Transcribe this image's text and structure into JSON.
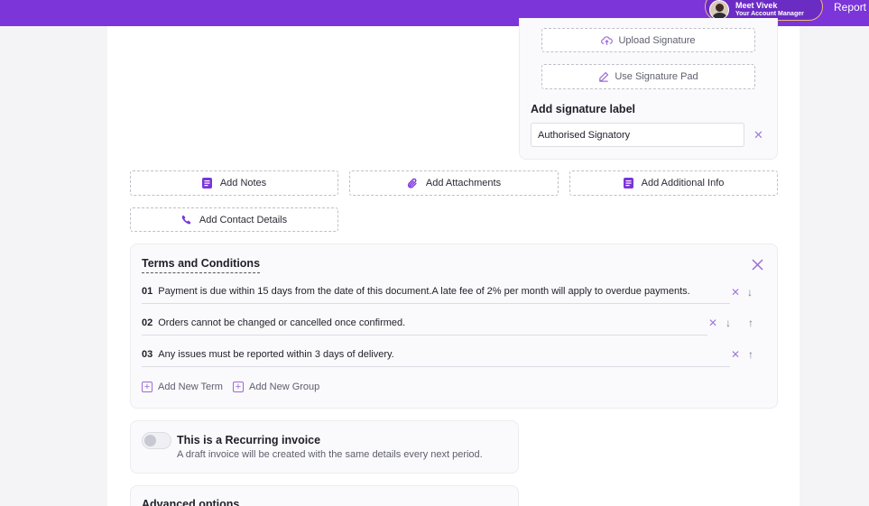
{
  "topbar": {
    "manager_name": "Meet Vivek",
    "manager_role": "Your Account Manager",
    "report_label": "Report a"
  },
  "signature": {
    "upload_label": "Upload Signature",
    "pad_label": "Use Signature Pad",
    "label_title": "Add signature label",
    "label_value": "Authorised Signatory"
  },
  "actions": {
    "notes": "Add Notes",
    "attachments": "Add Attachments",
    "additional_info": "Add Additional Info",
    "contact": "Add Contact Details"
  },
  "terms": {
    "title": "Terms and Conditions",
    "items": [
      {
        "num": "01",
        "text": "Payment is due within 15 days from the date of this document.A late fee of 2% per month will apply to overdue payments."
      },
      {
        "num": "02",
        "text": "Orders cannot be changed or cancelled once confirmed."
      },
      {
        "num": "03",
        "text": "Any issues must be reported within 3 days of delivery."
      }
    ],
    "add_term": "Add New Term",
    "add_group": "Add New Group"
  },
  "recurring": {
    "title": "This is a Recurring invoice",
    "subtitle": "A draft invoice will be created with the same details every next period.",
    "enabled": false
  },
  "advanced": {
    "title": "Advanced options"
  },
  "colors": {
    "brand": "#7b35d9",
    "accent_icon": "#9b6ad6"
  }
}
